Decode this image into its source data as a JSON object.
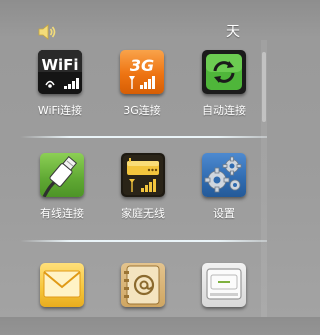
{
  "status_bar": {
    "icon": "speaker-icon",
    "text": "天"
  },
  "grid": {
    "items": [
      {
        "label": "WiFi连接",
        "icon": "wifi-icon"
      },
      {
        "label": "3G连接",
        "icon": "3g-icon"
      },
      {
        "label": "自动连接",
        "icon": "auto-connect-icon"
      },
      {
        "label": "有线连接",
        "icon": "wired-connection-icon"
      },
      {
        "label": "家庭无线",
        "icon": "home-wireless-router-icon"
      },
      {
        "label": "设置",
        "icon": "settings-gears-icon"
      },
      {
        "label": "",
        "icon": "mail-icon"
      },
      {
        "label": "",
        "icon": "contacts-at-icon"
      },
      {
        "label": "",
        "icon": "storage-drive-icon"
      }
    ]
  },
  "icon_text": {
    "wifi": "WiFi",
    "threeg": "3G"
  },
  "colors": {
    "background": "#9b9b9b",
    "divider": "#eaf4f8",
    "label": "#ffffff",
    "threeg_orange": "#f07a14",
    "auto_green": "#4fb63a",
    "wired_green": "#6db33f",
    "settings_blue": "#2f6bb0",
    "mail_yellow": "#f5c53a"
  }
}
